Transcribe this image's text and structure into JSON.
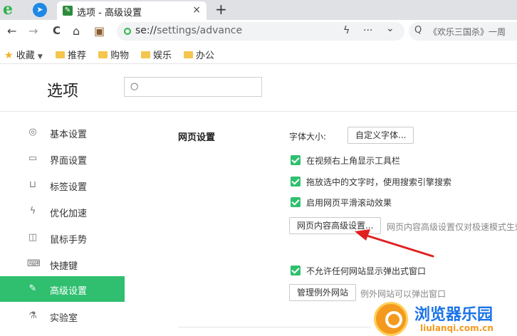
{
  "browser": {
    "logo_glyph": "e",
    "tab": {
      "title": "选项 - 高级设置",
      "close": "×"
    },
    "new_tab": "+",
    "toolbar": {
      "back": "←",
      "forward": "→",
      "reload": "C",
      "home": "⌂",
      "bag": "▣"
    },
    "address": {
      "scheme": "se://",
      "path": "settings/advance"
    },
    "omni_icons": {
      "bolt": "ϟ",
      "more": "···",
      "dropdown": "⌄"
    },
    "search_box": {
      "icon": "Q",
      "text": "《欢乐三国杀》一周"
    },
    "bookmarks": [
      {
        "label": "收藏",
        "kind": "favorites"
      },
      {
        "label": "推荐",
        "kind": "folder"
      },
      {
        "label": "购物",
        "kind": "folder"
      },
      {
        "label": "娱乐",
        "kind": "folder"
      },
      {
        "label": "办公",
        "kind": "folder"
      }
    ]
  },
  "page": {
    "title": "选项",
    "search": {
      "placeholder": "",
      "value": ""
    }
  },
  "sidebar": {
    "items": [
      {
        "label": "基本设置",
        "icon": "settings-icon",
        "active": false
      },
      {
        "label": "界面设置",
        "icon": "window-icon",
        "active": false
      },
      {
        "label": "标签设置",
        "icon": "tab-icon",
        "active": false
      },
      {
        "label": "优化加速",
        "icon": "lightning-icon",
        "active": false
      },
      {
        "label": "鼠标手势",
        "icon": "mouse-icon",
        "active": false
      },
      {
        "label": "快捷键",
        "icon": "keyboard-icon",
        "active": false
      },
      {
        "label": "高级设置",
        "icon": "wrench-icon",
        "active": true
      },
      {
        "label": "实验室",
        "icon": "flask-icon",
        "active": false
      }
    ]
  },
  "content": {
    "section_title": "网页设置",
    "font_size_label": "字体大小:",
    "custom_font_button": "自定义字体...",
    "checkboxes": [
      {
        "label": "在视频右上角显示工具栏",
        "checked": true
      },
      {
        "label": "拖放选中的文字时，使用搜索引擎搜索",
        "checked": true
      },
      {
        "label": "启用网页平滑滚动效果",
        "checked": true
      }
    ],
    "advanced_button": "网页内容高级设置...",
    "advanced_hint": "网页内容高级设置仅对极速模式生效",
    "popup_checkbox": {
      "label": "不允许任何网站显示弹出式窗口",
      "checked": true
    },
    "exceptions_button": "管理例外网站",
    "exceptions_hint": "例外网站可以弹出窗口"
  },
  "watermark": {
    "name": "浏览器乐园",
    "url": "liulanqi.com.cn"
  },
  "colors": {
    "accent": "#2fbf6f",
    "arrow": "#e02020",
    "watermark_blue": "#1a73e8",
    "watermark_orange": "#f39a1e"
  }
}
